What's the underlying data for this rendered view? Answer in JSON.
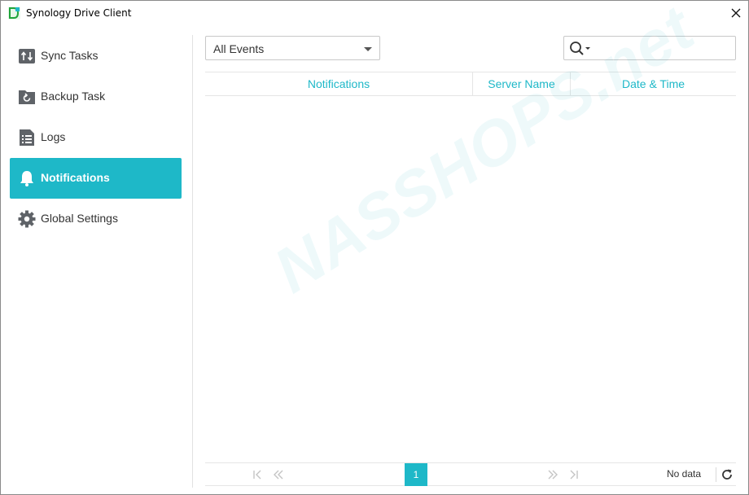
{
  "window": {
    "title": "Synology Drive Client"
  },
  "sidebar": {
    "items": [
      {
        "label": "Sync Tasks",
        "icon": "sync-arrows-icon"
      },
      {
        "label": "Backup Task",
        "icon": "backup-folder-icon"
      },
      {
        "label": "Logs",
        "icon": "logs-icon"
      },
      {
        "label": "Notifications",
        "icon": "bell-icon",
        "active": true
      },
      {
        "label": "Global Settings",
        "icon": "gear-icon"
      }
    ]
  },
  "filter": {
    "selected": "All Events"
  },
  "search": {
    "placeholder": "",
    "value": ""
  },
  "table": {
    "columns": [
      "Notifications",
      "Server Name",
      "Date & Time"
    ],
    "rows": []
  },
  "pager": {
    "current_page": "1",
    "status": "No data"
  },
  "watermark": "NASSHOPS.net",
  "colors": {
    "accent": "#1eb8c8",
    "sidebar_icon": "#5f6368",
    "text": "#333333"
  }
}
